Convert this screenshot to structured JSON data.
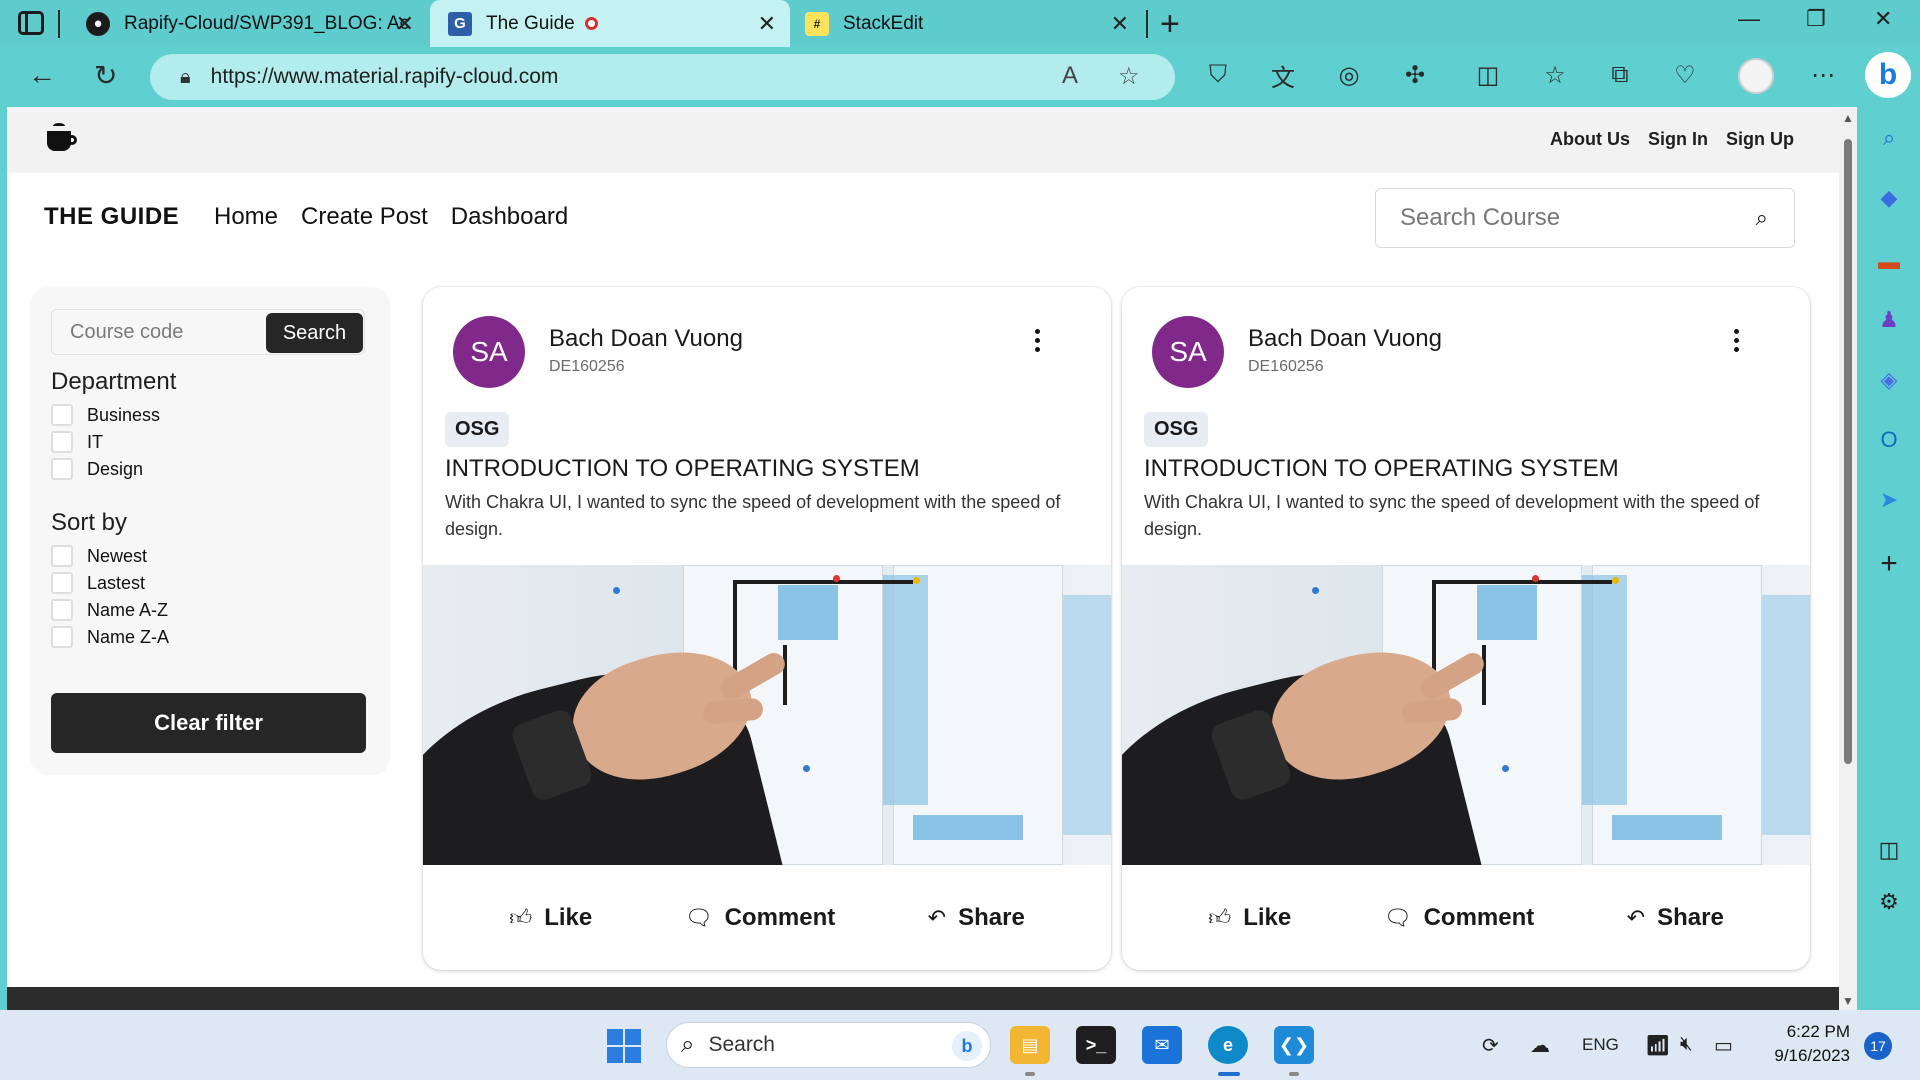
{
  "browser": {
    "tabs": [
      {
        "title": "Rapify-Cloud/SWP391_BLOG: Ac",
        "icon": "github-icon"
      },
      {
        "title": "The Guide",
        "icon": "the-guide-icon",
        "active": true
      },
      {
        "title": "StackEdit",
        "icon": "stackedit-icon"
      }
    ],
    "url_scheme": "https://",
    "url_rest": "www.material.rapify-cloud.com"
  },
  "site": {
    "top_links": [
      "About Us",
      "Sign In",
      "Sign Up"
    ],
    "brand": "THE GUIDE",
    "nav": [
      "Home",
      "Create Post",
      "Dashboard"
    ],
    "search_placeholder": "Search Course"
  },
  "filters": {
    "course_placeholder": "Course code",
    "search_label": "Search",
    "department_title": "Department",
    "departments": [
      "Business",
      "IT",
      "Design"
    ],
    "sort_title": "Sort by",
    "sort_options": [
      "Newest",
      "Lastest",
      "Name A-Z",
      "Name Z-A"
    ],
    "clear_label": "Clear filter"
  },
  "posts": [
    {
      "initials": "SA",
      "author": "Bach Doan Vuong",
      "author_id": "DE160256",
      "tag": "OSG",
      "title": "INTRODUCTION TO OPERATING SYSTEM",
      "description": "With Chakra UI, I wanted to sync the speed of development with the speed of design.",
      "actions": [
        "Like",
        "Comment",
        "Share"
      ]
    },
    {
      "initials": "SA",
      "author": "Bach Doan Vuong",
      "author_id": "DE160256",
      "tag": "OSG",
      "title": "INTRODUCTION TO OPERATING SYSTEM",
      "description": "With Chakra UI, I wanted to sync the speed of development with the speed of design.",
      "actions": [
        "Like",
        "Comment",
        "Share"
      ]
    }
  ],
  "taskbar": {
    "search_label": "Search",
    "language": "ENG",
    "time": "6:22 PM",
    "date": "9/16/2023",
    "notifications": "17"
  },
  "colors": {
    "browser_frame": "#5fcfd0",
    "avatar": "#80298a",
    "dark_button": "#262626"
  }
}
